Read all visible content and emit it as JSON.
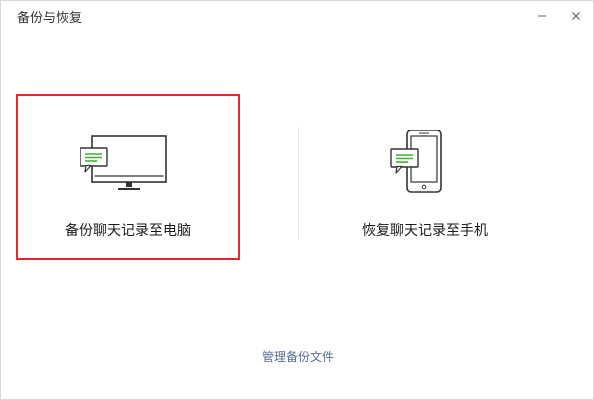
{
  "window": {
    "title": "备份与恢复"
  },
  "titlebar": {
    "minimize_icon": "minimize-icon",
    "close_icon": "close-icon"
  },
  "options": {
    "backup": {
      "label": "备份聊天记录至电脑",
      "icon": "computer-chat-icon",
      "selected": true
    },
    "restore": {
      "label": "恢复聊天记录至手机",
      "icon": "phone-chat-icon",
      "selected": false
    }
  },
  "footer": {
    "manage_label": "管理备份文件"
  },
  "colors": {
    "selection_border": "#e5282c",
    "link": "#586b95",
    "chat_green": "#3eb135"
  }
}
